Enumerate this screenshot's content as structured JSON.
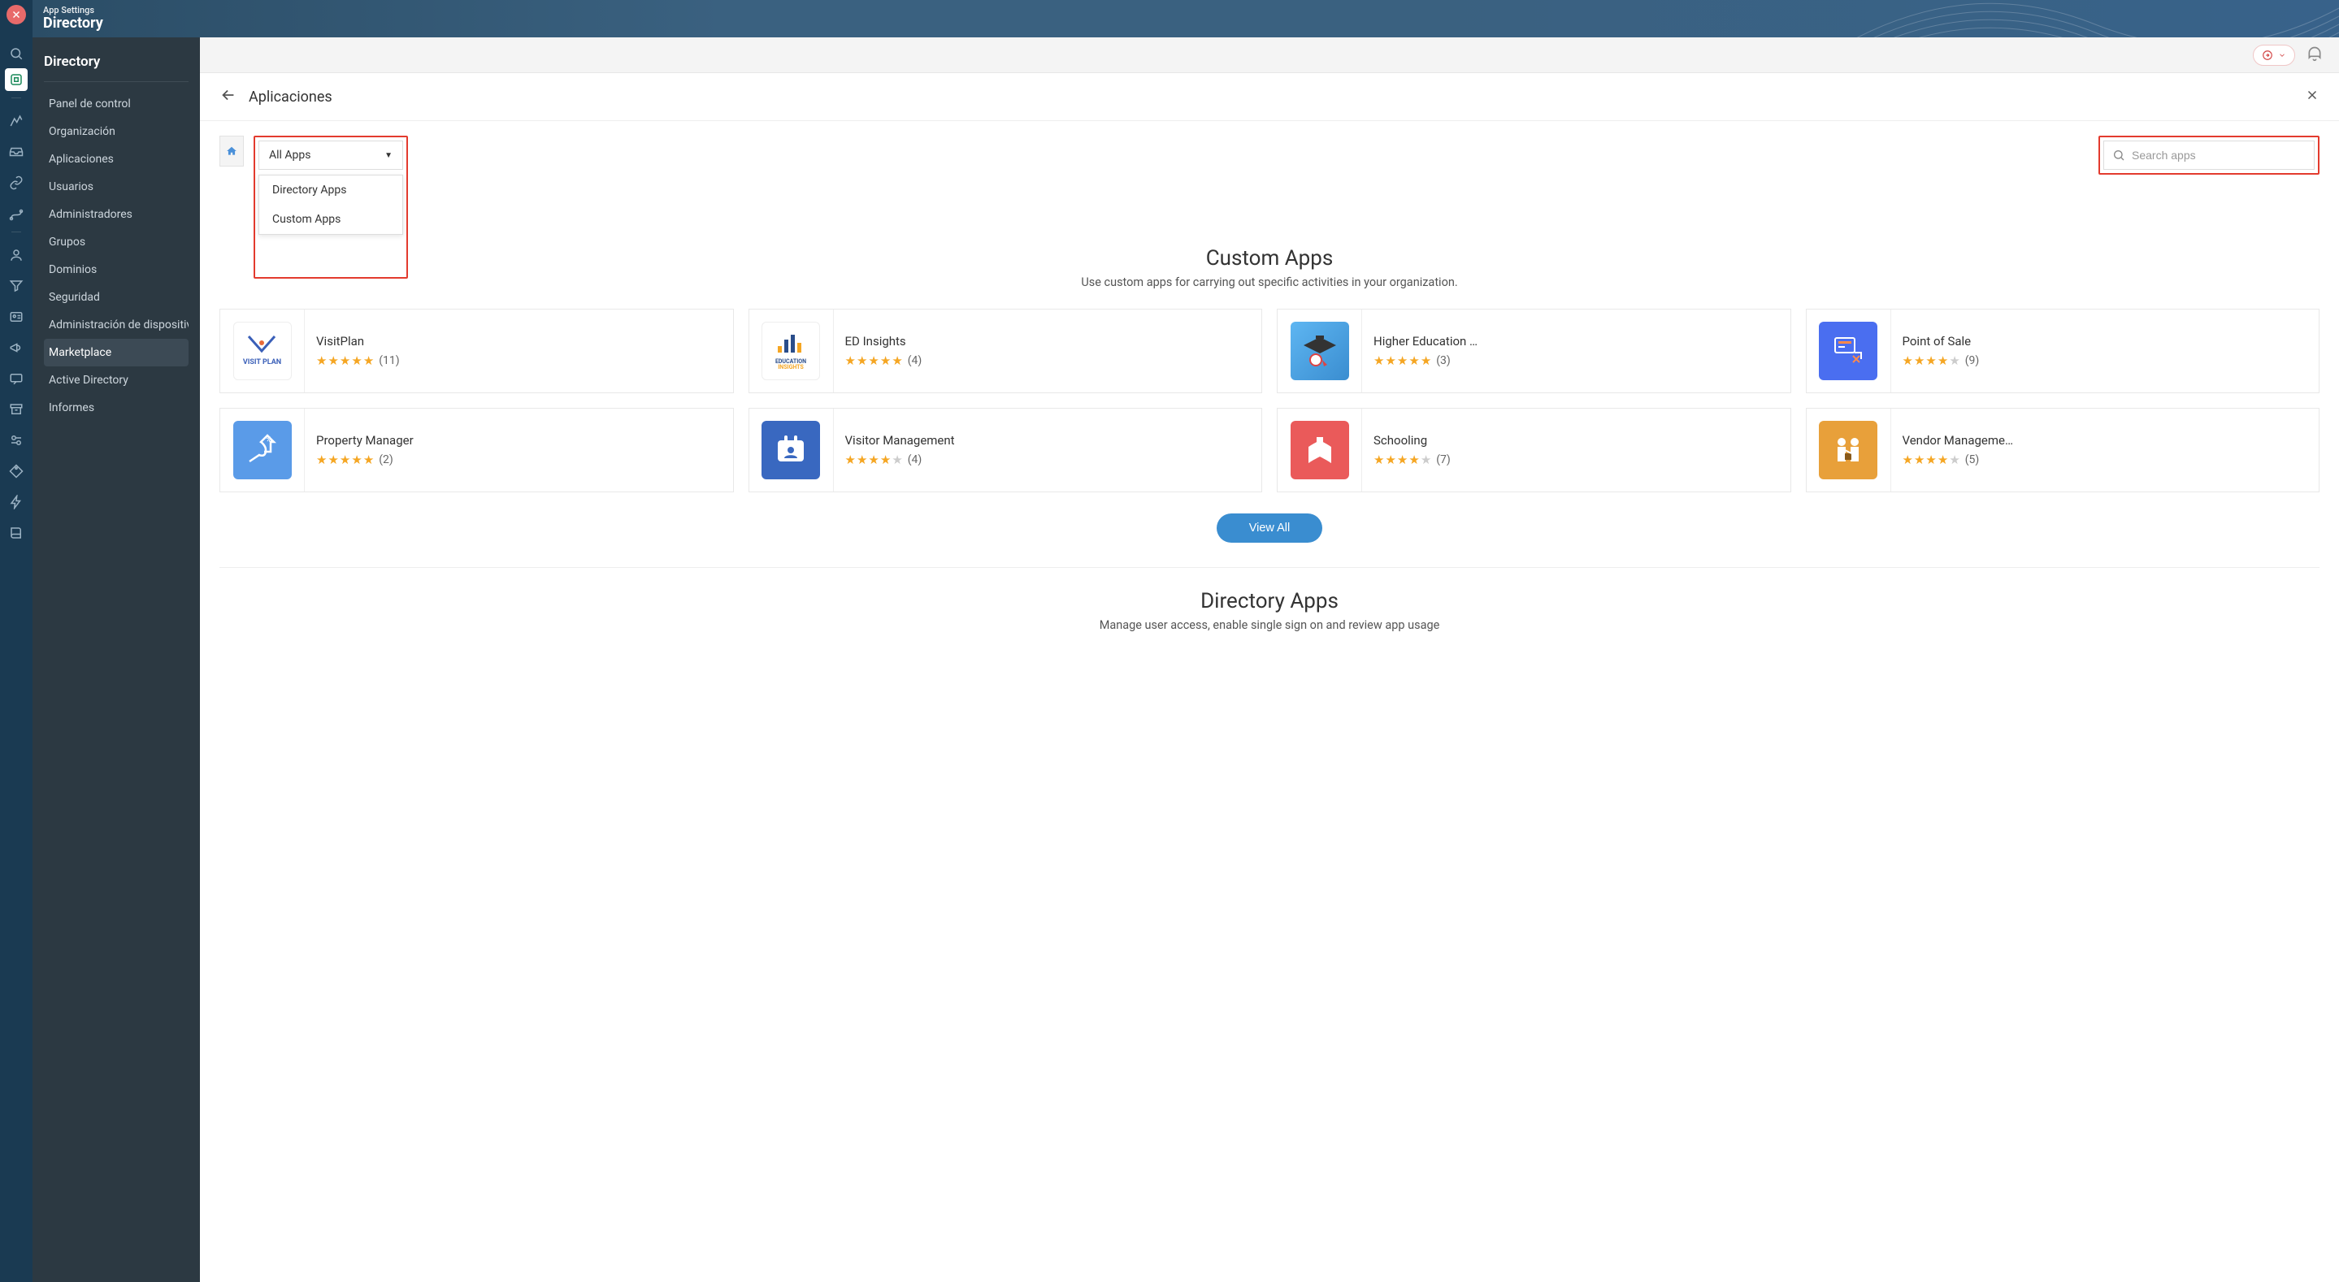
{
  "header": {
    "subtitle": "App Settings",
    "title": "Directory"
  },
  "sidebar": {
    "title": "Directory",
    "items": [
      {
        "label": "Panel de control"
      },
      {
        "label": "Organización"
      },
      {
        "label": "Aplicaciones"
      },
      {
        "label": "Usuarios"
      },
      {
        "label": "Administradores"
      },
      {
        "label": "Grupos"
      },
      {
        "label": "Dominios"
      },
      {
        "label": "Seguridad"
      },
      {
        "label": "Administración de dispositivos"
      },
      {
        "label": "Marketplace"
      },
      {
        "label": "Active Directory"
      },
      {
        "label": "Informes"
      }
    ],
    "active_index": 9
  },
  "page": {
    "title": "Aplicaciones"
  },
  "filter": {
    "selected": "All Apps",
    "options": [
      "Directory Apps",
      "Custom Apps"
    ]
  },
  "search": {
    "placeholder": "Search apps",
    "value": ""
  },
  "sections": {
    "custom": {
      "title": "Custom Apps",
      "subtitle": "Use custom apps for carrying out specific activities in your organization.",
      "view_all": "View All",
      "apps": [
        {
          "name": "VisitPlan",
          "rating": 5,
          "count": 11,
          "icon": "visitplan"
        },
        {
          "name": "ED Insights",
          "rating": 5,
          "count": 4,
          "icon": "edinsights"
        },
        {
          "name": "Higher Education …",
          "rating": 5,
          "count": 3,
          "icon": "highered"
        },
        {
          "name": "Point of Sale",
          "rating": 4,
          "count": 9,
          "icon": "pos"
        },
        {
          "name": "Property Manager",
          "rating": 5,
          "count": 2,
          "icon": "property"
        },
        {
          "name": "Visitor Management",
          "rating": 4,
          "count": 4,
          "icon": "visitor"
        },
        {
          "name": "Schooling",
          "rating": 4,
          "count": 7,
          "icon": "schooling"
        },
        {
          "name": "Vendor Manageme…",
          "rating": 4,
          "count": 5,
          "icon": "vendor"
        }
      ]
    },
    "directory": {
      "title": "Directory Apps",
      "subtitle": "Manage user access, enable single sign on and review app usage"
    }
  }
}
